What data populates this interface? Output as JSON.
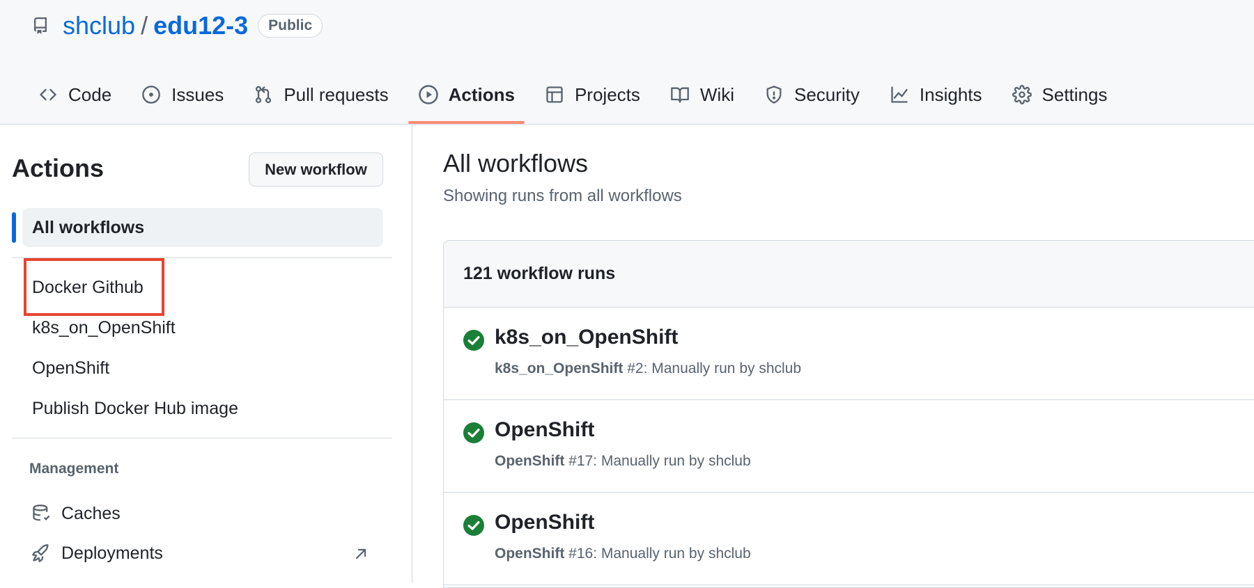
{
  "repo": {
    "owner": "shclub",
    "separator": "/",
    "name": "edu12-3",
    "visibility": "Public"
  },
  "nav": {
    "tabs": [
      {
        "label": "Code",
        "icon": "code-icon"
      },
      {
        "label": "Issues",
        "icon": "issue-icon"
      },
      {
        "label": "Pull requests",
        "icon": "pull-request-icon"
      },
      {
        "label": "Actions",
        "icon": "play-icon",
        "active": true
      },
      {
        "label": "Projects",
        "icon": "table-icon"
      },
      {
        "label": "Wiki",
        "icon": "book-icon"
      },
      {
        "label": "Security",
        "icon": "shield-icon"
      },
      {
        "label": "Insights",
        "icon": "graph-icon"
      },
      {
        "label": "Settings",
        "icon": "gear-icon"
      }
    ]
  },
  "sidebar": {
    "title": "Actions",
    "new_workflow": "New workflow",
    "all_workflows": "All workflows",
    "workflows": [
      "Docker Github",
      "k8s_on_OpenShift",
      "OpenShift",
      "Publish Docker Hub image"
    ],
    "management_label": "Management",
    "management": [
      {
        "label": "Caches",
        "icon": "database-icon"
      },
      {
        "label": "Deployments",
        "icon": "rocket-icon"
      }
    ]
  },
  "main": {
    "title": "All workflows",
    "subtitle": "Showing runs from all workflows",
    "runs_count": "121 workflow runs",
    "runs": [
      {
        "title": "k8s_on_OpenShift",
        "workflow": "k8s_on_OpenShift",
        "detail": " #2: Manually run by shclub"
      },
      {
        "title": "OpenShift",
        "workflow": "OpenShift",
        "detail": " #17: Manually run by shclub"
      },
      {
        "title": "OpenShift",
        "workflow": "OpenShift",
        "detail": " #16: Manually run by shclub"
      }
    ]
  },
  "colors": {
    "link": "#0969da",
    "active_underline": "#fd8c73",
    "success": "#1a7f37",
    "highlight_box": "#e8442f"
  }
}
